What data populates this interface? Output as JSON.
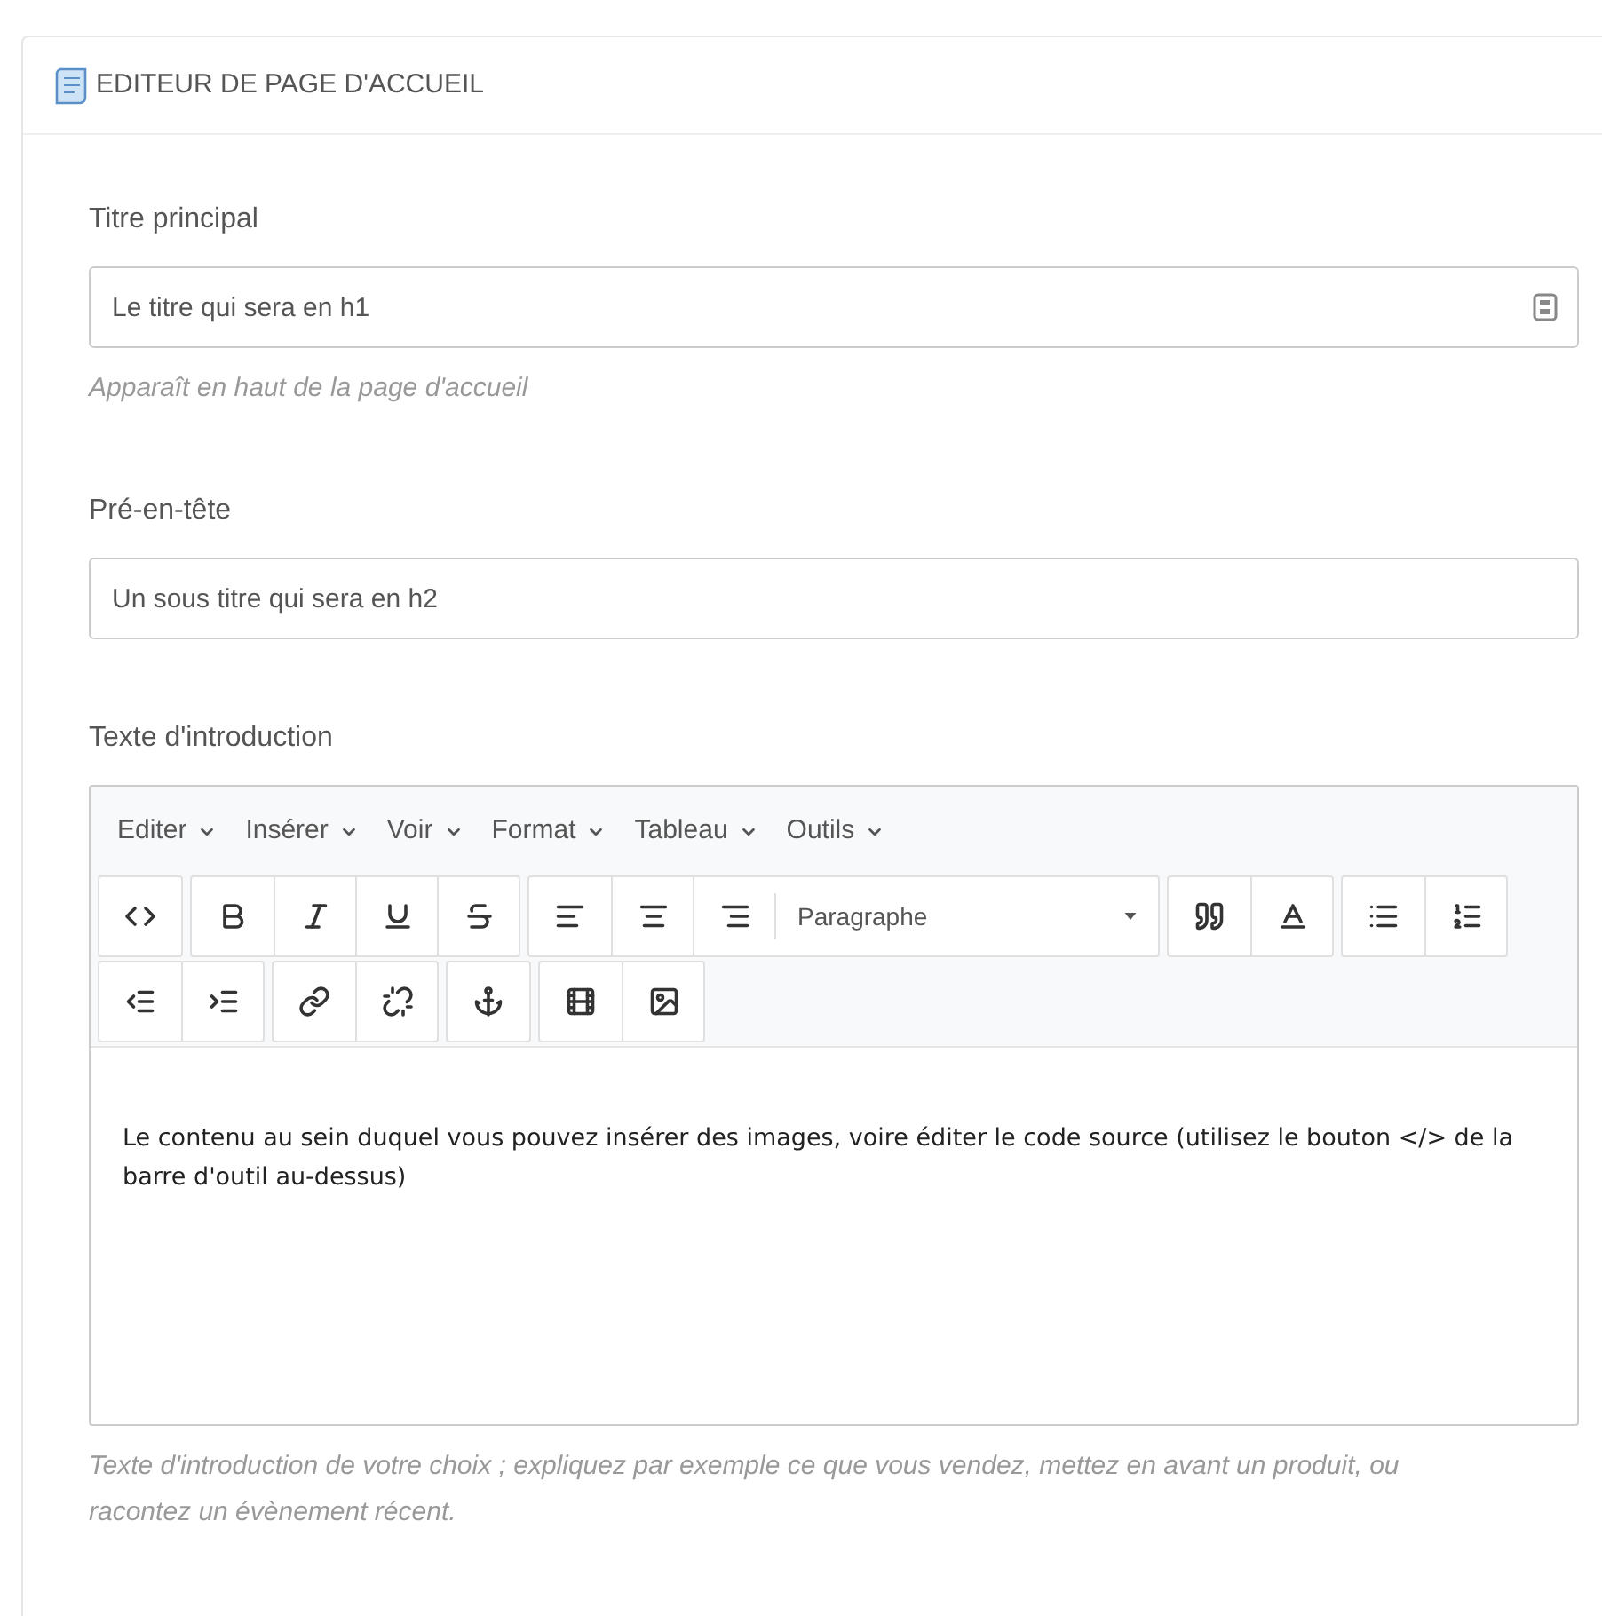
{
  "panel": {
    "title": "EDITEUR DE PAGE D'ACCUEIL"
  },
  "fields": [
    {
      "kind": "text",
      "label": "Titre principal",
      "value": "Le titre qui sera en h1",
      "addon_icon": true,
      "help": "Apparaît en haut de la page d'accueil"
    },
    {
      "kind": "text",
      "label": "Pré-en-tête",
      "value": "Un sous titre qui sera en h2"
    },
    {
      "kind": "editor",
      "label": "Texte d'introduction",
      "menu": [
        "Editer",
        "Insérer",
        "Voir",
        "Format",
        "Tableau",
        "Outils"
      ],
      "toolbar": [
        [
          [
            {
              "kind": "button"
            }
          ],
          [
            {
              "kind": "button"
            },
            {
              "kind": "button"
            },
            {
              "kind": "button"
            },
            {
              "kind": "button"
            }
          ],
          [
            {
              "kind": "button"
            },
            {
              "kind": "button"
            },
            {
              "kind": "button"
            },
            {
              "kind": "select",
              "value": "Paragraphe"
            }
          ],
          [
            {
              "kind": "button"
            },
            {
              "kind": "button"
            }
          ],
          [
            {
              "kind": "button"
            },
            {
              "kind": "button"
            }
          ]
        ],
        [
          [
            {
              "kind": "button"
            },
            {
              "kind": "button"
            }
          ],
          [
            {
              "kind": "button"
            },
            {
              "kind": "button"
            }
          ],
          [
            {
              "kind": "button"
            }
          ],
          [
            {
              "kind": "button"
            },
            {
              "kind": "button"
            }
          ]
        ]
      ],
      "content": "Le contenu au sein duquel vous pouvez insérer des images, voire éditer le code source (utilisez le bouton </> de la barre d'outil au-dessus)",
      "help": "Texte d'introduction de votre choix ; expliquez par exemple ce que vous vendez, mettez en avant un produit, ou racontez un évènement récent."
    }
  ]
}
